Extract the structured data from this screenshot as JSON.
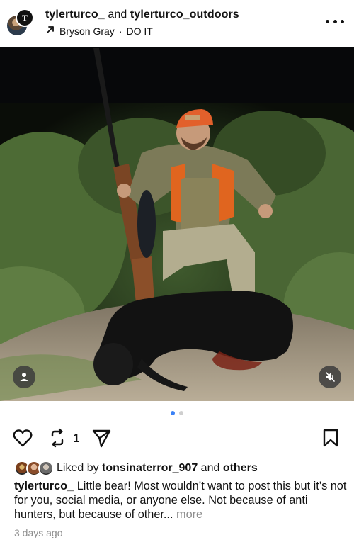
{
  "header": {
    "user1": "tylerturco_",
    "joiner": "and",
    "user2": "tylerturco_outdoors",
    "audio_artist": "Bryson Gray",
    "audio_separator": "·",
    "audio_title": "DO IT",
    "avatar_icon": "tt-monogram-icon",
    "more_icon": "more-horizontal-icon"
  },
  "media": {
    "tag_icon": "person-tag-icon",
    "mute_icon": "speaker-muted-icon"
  },
  "carousel": {
    "count": 2,
    "active_index": 0,
    "active_color": "#3b82f6",
    "inactive_color": "#cfcfcf"
  },
  "actions": {
    "like_icon": "heart-outline-icon",
    "repost_icon": "repost-icon",
    "repost_count": "1",
    "share_icon": "send-icon",
    "save_icon": "bookmark-outline-icon"
  },
  "likes": {
    "prefix": "Liked by",
    "user": "tonsinaterror_907",
    "joiner": "and",
    "others": "others"
  },
  "caption": {
    "user": "tylerturco_",
    "text": "Little bear! Most wouldn’t want to post this but it’s not for you, social media, or anyone else. Not because of anti hunters, but because of other...",
    "more": "more"
  },
  "timestamp": "3 days ago"
}
